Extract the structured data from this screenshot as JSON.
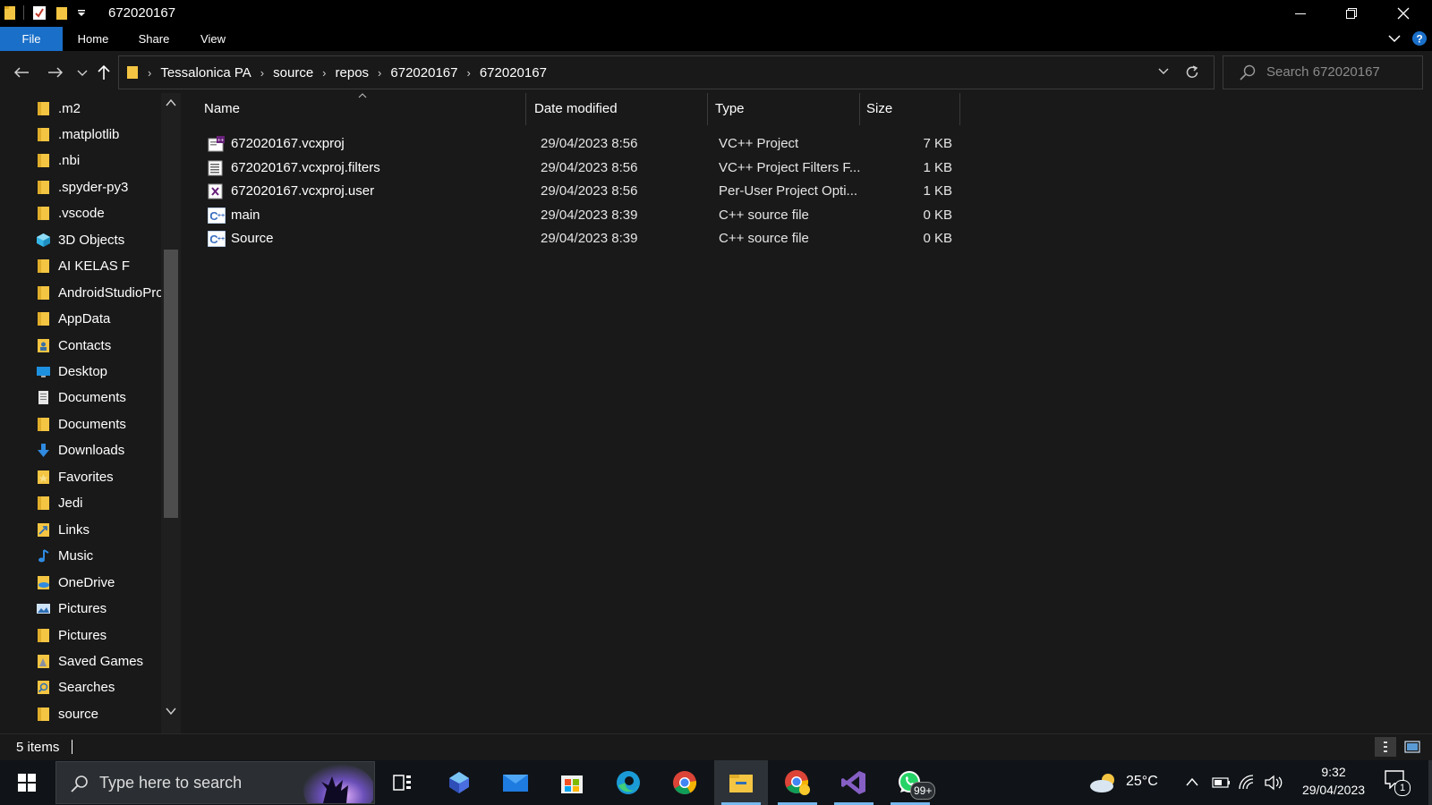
{
  "window": {
    "title": "672020167",
    "quick_access_icons": [
      "folder-icon",
      "properties-checkmark-icon",
      "new-folder-icon",
      "customize-dropdown-icon"
    ],
    "controls": [
      "minimize-icon",
      "restore-icon",
      "close-icon"
    ]
  },
  "ribbon": {
    "tabs": [
      {
        "label": "File",
        "active": true
      },
      {
        "label": "Home",
        "active": false
      },
      {
        "label": "Share",
        "active": false
      },
      {
        "label": "View",
        "active": false
      }
    ]
  },
  "address": {
    "crumbs": [
      "Tessalonica PA",
      "source",
      "repos",
      "672020167",
      "672020167"
    ]
  },
  "search": {
    "placeholder": "Search 672020167"
  },
  "nav": {
    "items": [
      {
        "label": ".m2",
        "icon": "folder-icon"
      },
      {
        "label": ".matplotlib",
        "icon": "folder-icon"
      },
      {
        "label": ".nbi",
        "icon": "folder-icon"
      },
      {
        "label": ".spyder-py3",
        "icon": "folder-icon"
      },
      {
        "label": ".vscode",
        "icon": "folder-icon"
      },
      {
        "label": "3D Objects",
        "icon": "cube-icon"
      },
      {
        "label": "AI KELAS F",
        "icon": "folder-icon"
      },
      {
        "label": "AndroidStudioProjects",
        "icon": "folder-icon"
      },
      {
        "label": "AppData",
        "icon": "folder-icon"
      },
      {
        "label": "Contacts",
        "icon": "contacts-icon"
      },
      {
        "label": "Desktop",
        "icon": "desktop-icon"
      },
      {
        "label": "Documents",
        "icon": "documents-icon"
      },
      {
        "label": "Documents",
        "icon": "folder-icon"
      },
      {
        "label": "Downloads",
        "icon": "download-arrow-icon"
      },
      {
        "label": "Favorites",
        "icon": "favorites-icon"
      },
      {
        "label": "Jedi",
        "icon": "folder-icon"
      },
      {
        "label": "Links",
        "icon": "links-icon"
      },
      {
        "label": "Music",
        "icon": "music-note-icon"
      },
      {
        "label": "OneDrive",
        "icon": "onedrive-icon"
      },
      {
        "label": "Pictures",
        "icon": "pictures-icon"
      },
      {
        "label": "Pictures",
        "icon": "folder-icon"
      },
      {
        "label": "Saved Games",
        "icon": "saved-games-icon"
      },
      {
        "label": "Searches",
        "icon": "searches-icon"
      },
      {
        "label": "source",
        "icon": "folder-icon"
      }
    ]
  },
  "columns": {
    "name": "Name",
    "date_modified": "Date modified",
    "type": "Type",
    "size": "Size"
  },
  "files": [
    {
      "name": "672020167.vcxproj",
      "date": "29/04/2023 8:56",
      "type": "VC++ Project",
      "size": "7 KB",
      "icon": "vcxproj-icon"
    },
    {
      "name": "672020167.vcxproj.filters",
      "date": "29/04/2023 8:56",
      "type": "VC++ Project Filters F...",
      "size": "1 KB",
      "icon": "vcxproj-filters-icon"
    },
    {
      "name": "672020167.vcxproj.user",
      "date": "29/04/2023 8:56",
      "type": "Per-User Project Opti...",
      "size": "1 KB",
      "icon": "vcxproj-user-icon"
    },
    {
      "name": "main",
      "date": "29/04/2023 8:39",
      "type": "C++ source file",
      "size": "0 KB",
      "icon": "cpp-file-icon"
    },
    {
      "name": "Source",
      "date": "29/04/2023 8:39",
      "type": "C++ source file",
      "size": "0 KB",
      "icon": "cpp-file-icon"
    }
  ],
  "status": {
    "item_count": "5 items",
    "view_icons": [
      "details-view-icon",
      "large-icons-view-icon"
    ]
  },
  "taskbar": {
    "search_placeholder": "Type here to search",
    "apps": [
      "task-view-icon",
      "copilot-icon",
      "mail-icon",
      "store-icon",
      "edge-icon",
      "chrome-icon",
      "file-explorer-icon",
      "chrome-canary-icon",
      "visual-studio-icon",
      "whatsapp-icon"
    ],
    "whatsapp_badge": "99+",
    "weather_temp": "25°C",
    "time": "9:32",
    "date": "29/04/2023",
    "notification_count": "1"
  },
  "colors": {
    "accent": "#1a6fc9",
    "folder": "#f4c542",
    "background": "#191919"
  }
}
